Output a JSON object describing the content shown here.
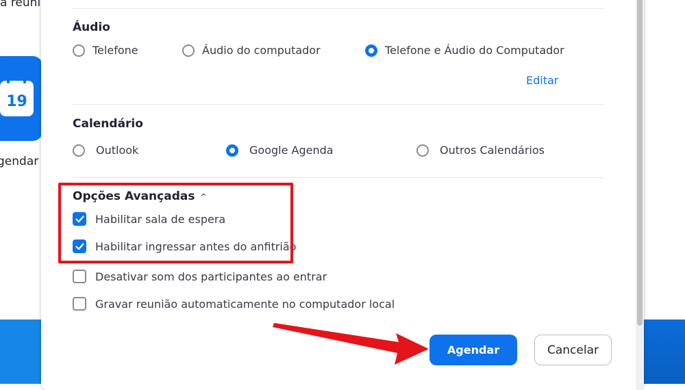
{
  "background": {
    "top_snippet": "a reuniã",
    "calendar_day": "19",
    "agendar_snippet": "gendar"
  },
  "audio": {
    "title": "Áudio",
    "options": [
      "Telefone",
      "Áudio do computador",
      "Telefone e Áudio do Computador"
    ],
    "selected": "Telefone e Áudio do Computador",
    "edit_label": "Editar"
  },
  "calendar": {
    "title": "Calendário",
    "options": [
      "Outlook",
      "Google Agenda",
      "Outros Calendários"
    ],
    "selected": "Google Agenda"
  },
  "advanced": {
    "title": "Opções Avançadas",
    "options": [
      {
        "label": "Habilitar sala de espera",
        "checked": true
      },
      {
        "label": "Habilitar ingressar antes do anfitrião",
        "checked": true
      },
      {
        "label": "Desativar som dos participantes ao entrar",
        "checked": false
      },
      {
        "label": "Gravar reunião automaticamente no computador local",
        "checked": false
      }
    ]
  },
  "actions": {
    "schedule_label": "Agendar",
    "cancel_label": "Cancelar"
  },
  "colors": {
    "accent": "#0e72ed",
    "annotation": "#e5141b"
  },
  "icons": {
    "calendar": "calendar-icon",
    "caret": "chevron-up-icon",
    "check": "check-icon"
  }
}
